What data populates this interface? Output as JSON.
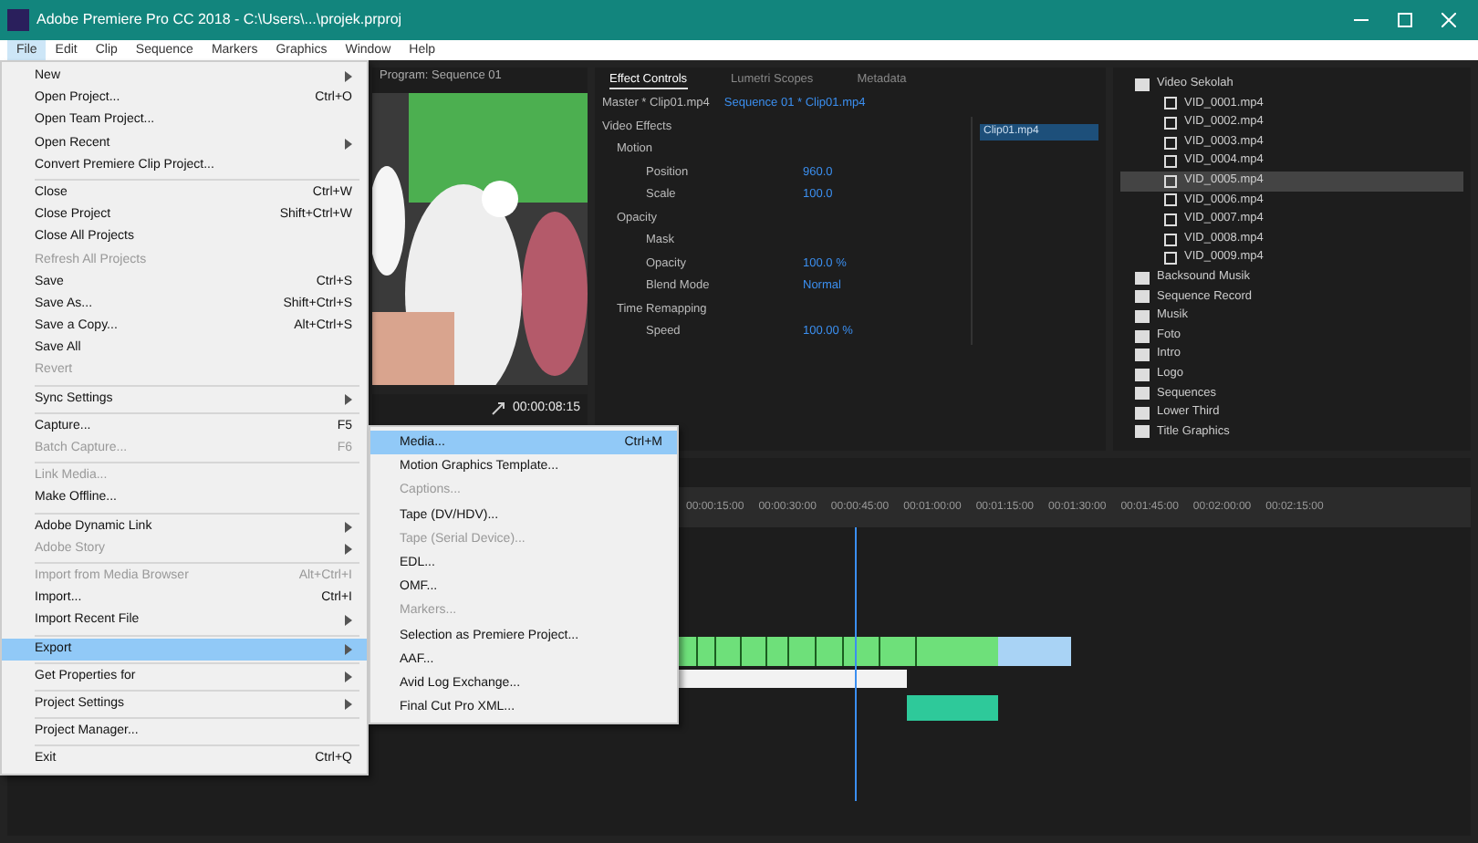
{
  "window": {
    "title": "Adobe Premiere Pro CC 2018 - C:\\Users\\...\\projek.prproj"
  },
  "menu_bar": [
    {
      "label": "File",
      "selected": true
    },
    {
      "label": "Edit",
      "selected": false
    },
    {
      "label": "Clip",
      "selected": false
    },
    {
      "label": "Sequence",
      "selected": false
    },
    {
      "label": "Markers",
      "selected": false
    },
    {
      "label": "Graphics",
      "selected": false
    },
    {
      "label": "Window",
      "selected": false
    },
    {
      "label": "Help",
      "selected": false
    }
  ],
  "file_menu": [
    {
      "kind": "item",
      "label": "New",
      "submenu": true,
      "disabled": false,
      "selected": false
    },
    {
      "kind": "item",
      "label": "Open Project...",
      "shortcut": "Ctrl+O",
      "submenu": false,
      "disabled": false,
      "selected": false
    },
    {
      "kind": "item",
      "label": "Open Team Project...",
      "submenu": false,
      "disabled": false,
      "selected": false
    },
    {
      "kind": "item",
      "label": "Open Recent",
      "submenu": true,
      "disabled": false,
      "selected": false
    },
    {
      "kind": "item",
      "label": "Convert Premiere Clip Project...",
      "submenu": false,
      "disabled": false,
      "selected": false
    },
    {
      "kind": "separator"
    },
    {
      "kind": "item",
      "label": "Close",
      "shortcut": "Ctrl+W",
      "submenu": false,
      "disabled": false,
      "selected": false
    },
    {
      "kind": "item",
      "label": "Close Project",
      "shortcut": "Shift+Ctrl+W",
      "submenu": false,
      "disabled": false,
      "selected": false
    },
    {
      "kind": "item",
      "label": "Close All Projects",
      "submenu": false,
      "disabled": false,
      "selected": false
    },
    {
      "kind": "item",
      "label": "Refresh All Projects",
      "submenu": false,
      "disabled": true,
      "selected": false
    },
    {
      "kind": "item",
      "label": "Save",
      "shortcut": "Ctrl+S",
      "submenu": false,
      "disabled": false,
      "selected": false
    },
    {
      "kind": "item",
      "label": "Save As...",
      "shortcut": "Shift+Ctrl+S",
      "submenu": false,
      "disabled": false,
      "selected": false
    },
    {
      "kind": "item",
      "label": "Save a Copy...",
      "shortcut": "Alt+Ctrl+S",
      "submenu": false,
      "disabled": false,
      "selected": false
    },
    {
      "kind": "item",
      "label": "Save All",
      "submenu": false,
      "disabled": false,
      "selected": false
    },
    {
      "kind": "item",
      "label": "Revert",
      "submenu": false,
      "disabled": true,
      "selected": false
    },
    {
      "kind": "separator"
    },
    {
      "kind": "item",
      "label": "Sync Settings",
      "submenu": true,
      "disabled": false,
      "selected": false
    },
    {
      "kind": "separator"
    },
    {
      "kind": "item",
      "label": "Capture...",
      "shortcut": "F5",
      "submenu": false,
      "disabled": false,
      "selected": false
    },
    {
      "kind": "item",
      "label": "Batch Capture...",
      "shortcut": "F6",
      "submenu": false,
      "disabled": true,
      "selected": false
    },
    {
      "kind": "separator"
    },
    {
      "kind": "item",
      "label": "Link Media...",
      "submenu": false,
      "disabled": true,
      "selected": false
    },
    {
      "kind": "item",
      "label": "Make Offline...",
      "submenu": false,
      "disabled": false,
      "selected": false
    },
    {
      "kind": "separator"
    },
    {
      "kind": "item",
      "label": "Adobe Dynamic Link",
      "submenu": true,
      "disabled": false,
      "selected": false
    },
    {
      "kind": "item",
      "label": "Adobe Story",
      "submenu": true,
      "disabled": true,
      "selected": false
    },
    {
      "kind": "separator"
    },
    {
      "kind": "item",
      "label": "Import from Media Browser",
      "shortcut": "Alt+Ctrl+I",
      "submenu": false,
      "disabled": true,
      "selected": false
    },
    {
      "kind": "item",
      "label": "Import...",
      "shortcut": "Ctrl+I",
      "submenu": false,
      "disabled": false,
      "selected": false
    },
    {
      "kind": "item",
      "label": "Import Recent File",
      "submenu": true,
      "disabled": false,
      "selected": false
    },
    {
      "kind": "separator"
    },
    {
      "kind": "item",
      "label": "Export",
      "submenu": true,
      "disabled": false,
      "selected": true
    },
    {
      "kind": "separator"
    },
    {
      "kind": "item",
      "label": "Get Properties for",
      "submenu": true,
      "disabled": false,
      "selected": false
    },
    {
      "kind": "separator"
    },
    {
      "kind": "item",
      "label": "Project Settings",
      "submenu": true,
      "disabled": false,
      "selected": false
    },
    {
      "kind": "separator"
    },
    {
      "kind": "item",
      "label": "Project Manager...",
      "submenu": false,
      "disabled": false,
      "selected": false
    },
    {
      "kind": "separator"
    },
    {
      "kind": "item",
      "label": "Exit",
      "shortcut": "Ctrl+Q",
      "submenu": false,
      "disabled": false,
      "selected": false
    }
  ],
  "export_menu": [
    {
      "label": "Media...",
      "shortcut": "Ctrl+M",
      "disabled": false,
      "selected": true
    },
    {
      "label": "Motion Graphics Template...",
      "disabled": false,
      "selected": false
    },
    {
      "label": "Captions...",
      "disabled": true,
      "selected": false
    },
    {
      "label": "Tape (DV/HDV)...",
      "disabled": false,
      "selected": false
    },
    {
      "label": "Tape (Serial Device)...",
      "disabled": true,
      "selected": false
    },
    {
      "label": "EDL...",
      "disabled": false,
      "selected": false
    },
    {
      "label": "OMF...",
      "disabled": false,
      "selected": false
    },
    {
      "label": "Markers...",
      "disabled": true,
      "selected": false
    },
    {
      "label": "Selection as Premiere Project...",
      "disabled": false,
      "selected": false
    },
    {
      "label": "AAF...",
      "disabled": false,
      "selected": false
    },
    {
      "label": "Avid Log Exchange...",
      "disabled": false,
      "selected": false
    },
    {
      "label": "Final Cut Pro XML...",
      "disabled": false,
      "selected": false
    }
  ],
  "program_monitor": {
    "title": "Program: Sequence 01",
    "timecode": "00:00:08:15"
  },
  "effect_controls": {
    "tabs": [
      {
        "label": "Effect Controls",
        "selected": true
      },
      {
        "label": "Lumetri Scopes",
        "selected": false
      },
      {
        "label": "Metadata",
        "selected": false
      }
    ],
    "source": "Master * Clip01.mp4",
    "target": "Sequence 01 * Clip01.mp4",
    "clip_label": "Clip01.mp4",
    "section": "Video Effects",
    "rows": [
      {
        "kind": "group",
        "label": "Motion"
      },
      {
        "kind": "property",
        "label": "Position",
        "value": "960.0"
      },
      {
        "kind": "property",
        "label": "Scale",
        "value": "100.0"
      },
      {
        "kind": "group",
        "label": "Opacity"
      },
      {
        "kind": "property",
        "label": "Mask"
      },
      {
        "kind": "property",
        "label": "Opacity",
        "value": "100.0 %"
      },
      {
        "kind": "property",
        "label": "Blend Mode",
        "value": "Normal"
      },
      {
        "kind": "group",
        "label": "Time Remapping"
      },
      {
        "kind": "property",
        "label": "Speed",
        "value": "100.00 %"
      }
    ]
  },
  "project_panel": {
    "items": [
      {
        "label": "Video Sekolah",
        "selected": false,
        "children": [
          {
            "label": "VID_0001.mp4",
            "selected": false
          },
          {
            "label": "VID_0002.mp4",
            "selected": false
          },
          {
            "label": "VID_0003.mp4",
            "selected": false
          },
          {
            "label": "VID_0004.mp4",
            "selected": false
          },
          {
            "label": "VID_0005.mp4",
            "selected": true
          },
          {
            "label": "VID_0006.mp4",
            "selected": false
          },
          {
            "label": "VID_0007.mp4",
            "selected": false
          },
          {
            "label": "VID_0008.mp4",
            "selected": false
          },
          {
            "label": "VID_0009.mp4",
            "selected": false
          }
        ]
      },
      {
        "label": "Backsound Musik",
        "selected": false
      },
      {
        "label": "Sequence Record",
        "selected": false
      },
      {
        "label": "Musik",
        "selected": false
      },
      {
        "label": "Foto",
        "selected": false
      },
      {
        "label": "Intro",
        "selected": false
      },
      {
        "label": "Logo",
        "selected": false
      },
      {
        "label": "Sequences",
        "selected": false
      },
      {
        "label": "Lower Third",
        "selected": false
      },
      {
        "label": "Title Graphics",
        "selected": false
      }
    ]
  },
  "timeline": {
    "ruler": [
      "00:00:15:00",
      "00:00:30:00",
      "00:00:45:00",
      "00:01:00:00",
      "00:01:15:00",
      "00:01:30:00",
      "00:01:45:00",
      "00:02:00:00",
      "00:02:15:00"
    ]
  }
}
